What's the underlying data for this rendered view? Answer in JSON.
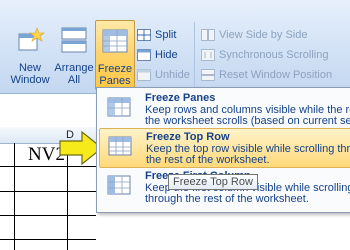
{
  "ribbon": {
    "new_window": "New\nWindow",
    "new_window_l1": "New",
    "new_window_l2": "Window",
    "arrange_l1": "Arrange",
    "arrange_l2": "All",
    "freeze_l1": "Freeze",
    "freeze_l2": "Panes",
    "freeze_caret": "▾",
    "split": "Split",
    "hide": "Hide",
    "unhide": "Unhide",
    "view_side_by_side": "View Side by Side",
    "synchronous_scrolling": "Synchronous Scrolling",
    "reset_window_position": "Reset Window Position"
  },
  "sheet": {
    "column_d": "D",
    "cell_text": "NV2"
  },
  "menu": {
    "items": [
      {
        "title": "Freeze Panes",
        "desc1": "Keep rows and columns visible while the rest",
        "desc2": "the worksheet scrolls (based on current sele"
      },
      {
        "title": "Freeze Top Row",
        "desc1": "Keep the top row visible while scrolling throu",
        "desc2": "the rest of the worksheet."
      },
      {
        "title": "Freeze First Column",
        "desc1": "Keep the first column visible while scrolling",
        "desc2": "through the rest of the worksheet."
      }
    ]
  },
  "tooltip": {
    "text": "Freeze Top Row"
  },
  "colors": {
    "highlight": "#ffd97a",
    "ribbon": "#d2e2f6",
    "text": "#15428b",
    "arrow": "#f7ea1a"
  }
}
